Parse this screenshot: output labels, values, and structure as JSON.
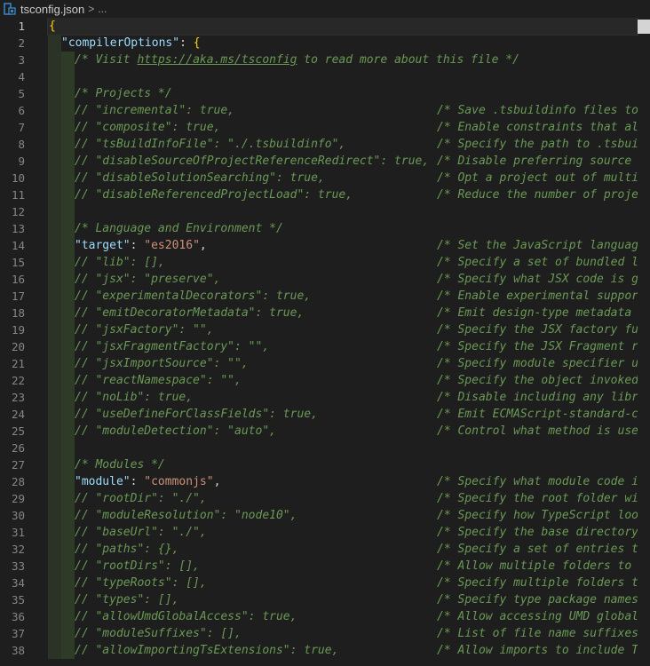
{
  "breadcrumb": {
    "file": "tsconfig.json",
    "separator": ">",
    "more": "..."
  },
  "lines": [
    {
      "n": "1",
      "kind": "open",
      "text": "{"
    },
    {
      "n": "2",
      "kind": "prop",
      "key": "\"compilerOptions\"",
      "sep": ": ",
      "value": "{"
    },
    {
      "n": "3",
      "kind": "visit",
      "pre": "/* Visit ",
      "link": "https://aka.ms/tsconfig",
      "post": " to read more about this file */"
    },
    {
      "n": "4",
      "kind": "blank"
    },
    {
      "n": "5",
      "kind": "section",
      "text": "/* Projects */"
    },
    {
      "n": "6",
      "kind": "opt",
      "text": "// \"incremental\": true,",
      "comment": "/* Save .tsbuildinfo files to"
    },
    {
      "n": "7",
      "kind": "opt",
      "text": "// \"composite\": true,",
      "comment": "/* Enable constraints that all"
    },
    {
      "n": "8",
      "kind": "opt",
      "text": "// \"tsBuildInfoFile\": \"./.tsbuildinfo\",",
      "comment": "/* Specify the path to .tsbuil"
    },
    {
      "n": "9",
      "kind": "opt",
      "text": "// \"disableSourceOfProjectReferenceRedirect\": true,",
      "comment": "/* Disable preferring source f"
    },
    {
      "n": "10",
      "kind": "opt",
      "text": "// \"disableSolutionSearching\": true,",
      "comment": "/* Opt a project out of multi-"
    },
    {
      "n": "11",
      "kind": "opt",
      "text": "// \"disableReferencedProjectLoad\": true,",
      "comment": "/* Reduce the number of projec"
    },
    {
      "n": "12",
      "kind": "blank"
    },
    {
      "n": "13",
      "kind": "section",
      "text": "/* Language and Environment */"
    },
    {
      "n": "14",
      "kind": "active",
      "key": "\"target\"",
      "value": "\"es2016\"",
      "comment": "/* Set the JavaScript language"
    },
    {
      "n": "15",
      "kind": "opt",
      "text": "// \"lib\": [],",
      "comment": "/* Specify a set of bundled li"
    },
    {
      "n": "16",
      "kind": "opt",
      "text": "// \"jsx\": \"preserve\",",
      "comment": "/* Specify what JSX code is ge"
    },
    {
      "n": "17",
      "kind": "opt",
      "text": "// \"experimentalDecorators\": true,",
      "comment": "/* Enable experimental support"
    },
    {
      "n": "18",
      "kind": "opt",
      "text": "// \"emitDecoratorMetadata\": true,",
      "comment": "/* Emit design-type metadata f"
    },
    {
      "n": "19",
      "kind": "opt",
      "text": "// \"jsxFactory\": \"\",",
      "comment": "/* Specify the JSX factory fun"
    },
    {
      "n": "20",
      "kind": "opt",
      "text": "// \"jsxFragmentFactory\": \"\",",
      "comment": "/* Specify the JSX Fragment re"
    },
    {
      "n": "21",
      "kind": "opt",
      "text": "// \"jsxImportSource\": \"\",",
      "comment": "/* Specify module specifier us"
    },
    {
      "n": "22",
      "kind": "opt",
      "text": "// \"reactNamespace\": \"\",",
      "comment": "/* Specify the object invoked"
    },
    {
      "n": "23",
      "kind": "opt",
      "text": "// \"noLib\": true,",
      "comment": "/* Disable including any libra"
    },
    {
      "n": "24",
      "kind": "opt",
      "text": "// \"useDefineForClassFields\": true,",
      "comment": "/* Emit ECMAScript-standard-co"
    },
    {
      "n": "25",
      "kind": "opt",
      "text": "// \"moduleDetection\": \"auto\",",
      "comment": "/* Control what method is used"
    },
    {
      "n": "26",
      "kind": "blank"
    },
    {
      "n": "27",
      "kind": "section",
      "text": "/* Modules */"
    },
    {
      "n": "28",
      "kind": "active",
      "key": "\"module\"",
      "value": "\"commonjs\"",
      "comment": "/* Specify what module code is"
    },
    {
      "n": "29",
      "kind": "opt",
      "text": "// \"rootDir\": \"./\",",
      "comment": "/* Specify the root folder wit"
    },
    {
      "n": "30",
      "kind": "opt",
      "text": "// \"moduleResolution\": \"node10\",",
      "comment": "/* Specify how TypeScript look"
    },
    {
      "n": "31",
      "kind": "opt",
      "text": "// \"baseUrl\": \"./\",",
      "comment": "/* Specify the base directory"
    },
    {
      "n": "32",
      "kind": "opt",
      "text": "// \"paths\": {},",
      "comment": "/* Specify a set of entries th"
    },
    {
      "n": "33",
      "kind": "opt",
      "text": "// \"rootDirs\": [],",
      "comment": "/* Allow multiple folders to b"
    },
    {
      "n": "34",
      "kind": "opt",
      "text": "// \"typeRoots\": [],",
      "comment": "/* Specify multiple folders th"
    },
    {
      "n": "35",
      "kind": "opt",
      "text": "// \"types\": [],",
      "comment": "/* Specify type package names"
    },
    {
      "n": "36",
      "kind": "opt",
      "text": "// \"allowUmdGlobalAccess\": true,",
      "comment": "/* Allow accessing UMD globals"
    },
    {
      "n": "37",
      "kind": "opt",
      "text": "// \"moduleSuffixes\": [],",
      "comment": "/* List of file name suffixes"
    },
    {
      "n": "38",
      "kind": "opt",
      "text": "// \"allowImportingTsExtensions\": true,",
      "comment": "/* Allow imports to include Ty"
    }
  ],
  "colors": {
    "background": "#1e1e1e",
    "comment": "#6a9955",
    "key": "#9cdcfe",
    "string": "#ce9178",
    "brace": "#ffd700",
    "lineNumber": "#858585"
  }
}
